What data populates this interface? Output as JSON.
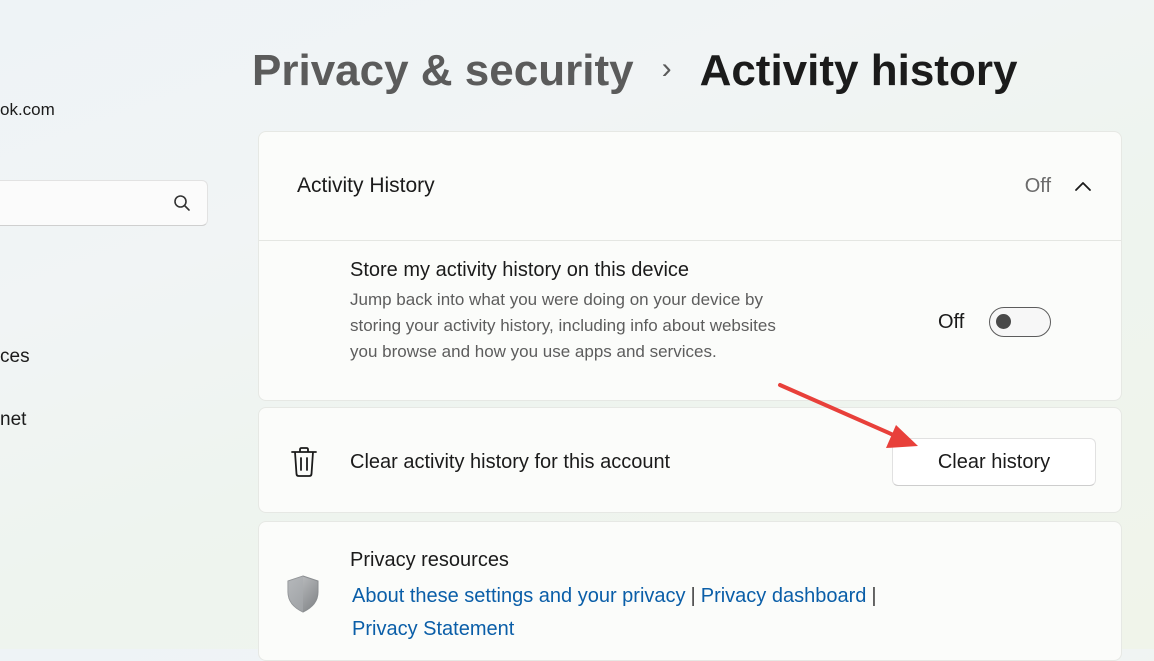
{
  "sidebar": {
    "account_email_fragment": "ok.com",
    "search": {
      "placeholder": ""
    },
    "items": [
      {
        "label": "ces"
      },
      {
        "label": "net"
      }
    ]
  },
  "breadcrumb": {
    "parent": "Privacy & security",
    "separator": "›",
    "current": "Activity history"
  },
  "activity_card": {
    "title": "Activity History",
    "status": "Off",
    "setting": {
      "title": "Store my activity history on this device",
      "description": "Jump back into what you were doing on your device by storing your activity history, including info about websites you browse and how you use apps and services.",
      "toggle_label": "Off",
      "toggle_on": false
    }
  },
  "clear_card": {
    "label": "Clear activity history for this account",
    "button": "Clear history"
  },
  "resources_card": {
    "title": "Privacy resources",
    "links": [
      "About these settings and your privacy",
      "Privacy dashboard",
      "Privacy Statement"
    ],
    "separator": "|"
  },
  "colors": {
    "link": "#0a5ea8",
    "annotation_arrow": "#e8403a"
  },
  "icons": {
    "search": "search-icon",
    "chevron": "chevron-up-icon",
    "trash": "trash-icon",
    "shield": "shield-icon"
  }
}
